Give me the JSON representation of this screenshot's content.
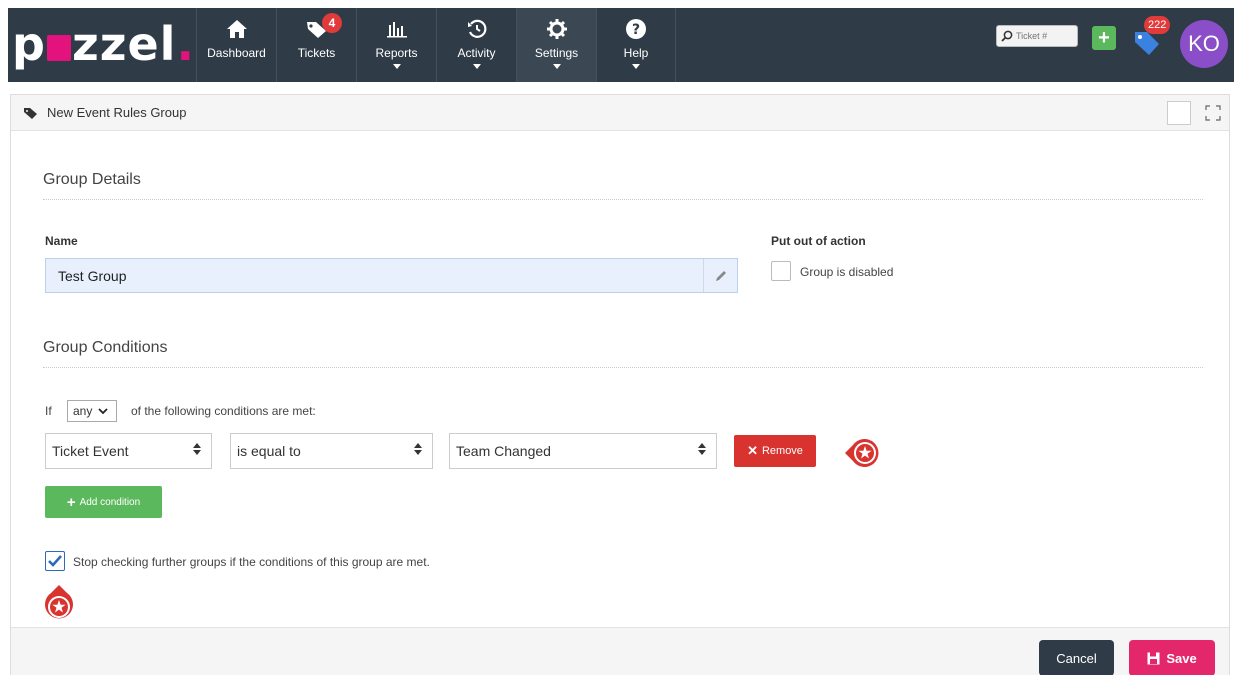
{
  "app": {
    "logo_text_pre": "p",
    "logo_text_post": "zzel",
    "logo_dot": ".",
    "brand_color": "#e4127d"
  },
  "nav": {
    "items": [
      {
        "label": "Dashboard",
        "icon": "home-icon"
      },
      {
        "label": "Tickets",
        "icon": "tag-icon",
        "badge": "4"
      },
      {
        "label": "Reports",
        "icon": "bar-chart-icon",
        "dropdown": true
      },
      {
        "label": "Activity",
        "icon": "history-icon",
        "dropdown": true
      },
      {
        "label": "Settings",
        "icon": "gear-icon",
        "dropdown": true,
        "active": true
      },
      {
        "label": "Help",
        "icon": "help-icon",
        "dropdown": true
      }
    ],
    "ticket_search_placeholder": "Ticket #",
    "notifications_count": "222",
    "avatar_initials": "KO"
  },
  "panel": {
    "title": "New Event Rules Group"
  },
  "group_details": {
    "heading": "Group Details",
    "name_label": "Name",
    "name_value": "Test Group",
    "out_of_action_label": "Put out of action",
    "disabled_label": "Group is disabled",
    "disabled_checked": false
  },
  "group_conditions": {
    "heading": "Group Conditions",
    "if_text": "If",
    "match_value": "any",
    "suffix_text": "of the following conditions are met:",
    "condition": {
      "field": "Ticket Event",
      "operator": "is equal to",
      "value": "Team Changed"
    },
    "remove_label": "Remove",
    "add_label": "Add condition",
    "stop_label": "Stop checking further groups if the conditions of this group are met.",
    "stop_checked": true
  },
  "footer": {
    "cancel_label": "Cancel",
    "save_label": "Save"
  },
  "colors": {
    "navbar": "#2f3c47",
    "remove": "#d9332f",
    "add": "#5cb85c",
    "save": "#e4276b",
    "marker": "#d9332f"
  }
}
